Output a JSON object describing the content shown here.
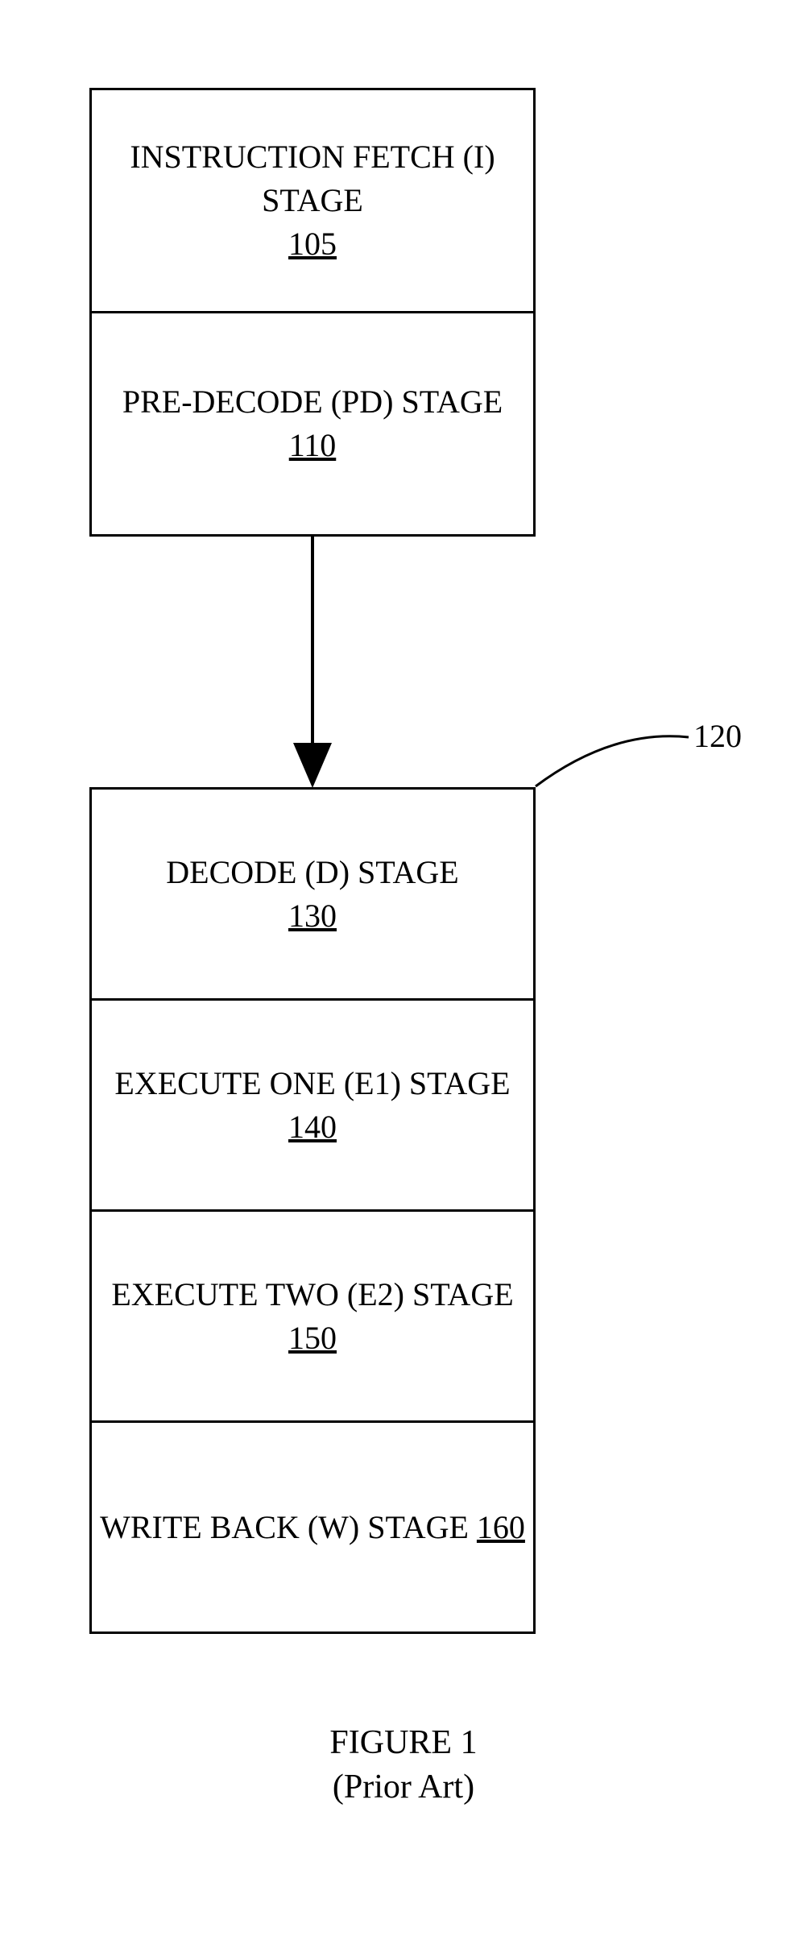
{
  "stages": {
    "fetch": {
      "title": "INSTRUCTION FETCH (I) STAGE",
      "ref": "105"
    },
    "predecode": {
      "title": "PRE-DECODE (PD) STAGE",
      "ref": "110"
    },
    "decode": {
      "title": "DECODE (D) STAGE",
      "ref": "130"
    },
    "e1": {
      "title": "EXECUTE ONE (E1) STAGE",
      "ref": "140"
    },
    "e2": {
      "title": "EXECUTE TWO (E2) STAGE",
      "ref": "150"
    },
    "wb": {
      "title_pre": "WRITE BACK (W) STAGE ",
      "ref": "160"
    }
  },
  "labels": {
    "lower_group_ref": "120"
  },
  "caption": {
    "line1": "FIGURE 1",
    "line2": "(Prior Art)"
  }
}
